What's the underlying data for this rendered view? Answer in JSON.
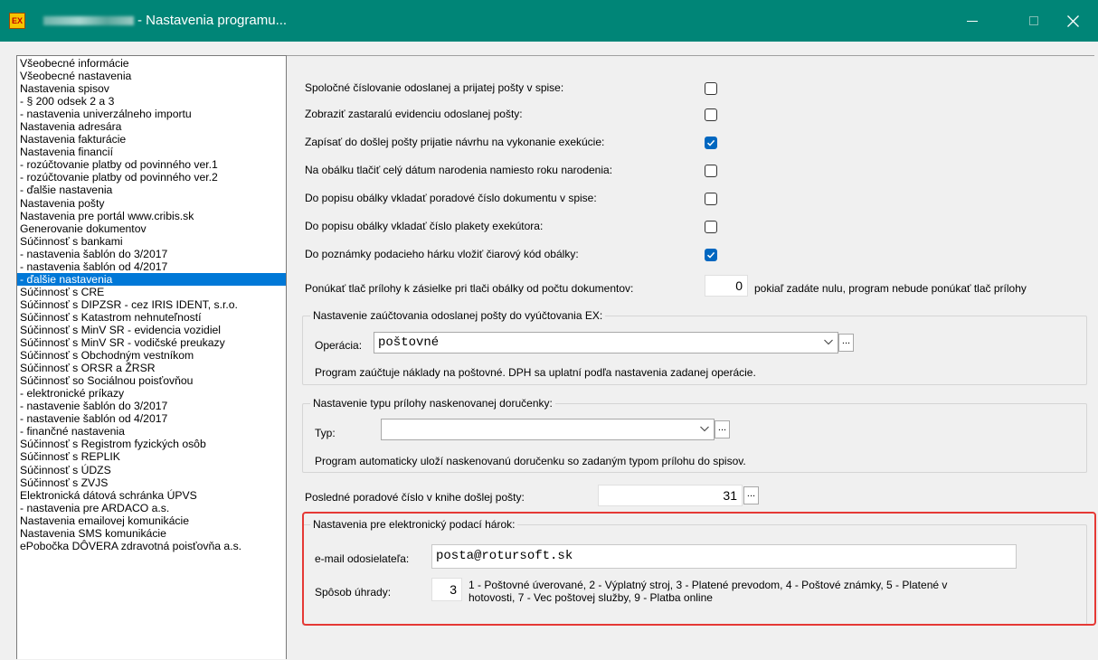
{
  "window": {
    "title": "- Nastavenia programu...",
    "icon_text": "EX",
    "controls": [
      "minimize-icon",
      "maximize-icon",
      "close-icon"
    ]
  },
  "tree": {
    "selected_index": 17,
    "items": [
      "Všeobecné informácie",
      "Všeobecné nastavenia",
      "Nastavenia spisov",
      " - § 200 odsek 2 a 3",
      " - nastavenia univerzálneho importu",
      "Nastavenia adresára",
      "Nastavenia fakturácie",
      "Nastavenia financií",
      " - rozúčtovanie platby od povinného ver.1",
      " - rozúčtovanie platby od povinného ver.2",
      " - ďalšie nastavenia",
      "Nastavenia pošty",
      "Nastavenia pre portál www.cribis.sk",
      "Generovanie dokumentov",
      "Súčinnosť s bankami",
      " - nastavenia šablón do 3/2017",
      " - nastavenia šablón od 4/2017",
      " - ďalšie nastavenia",
      "Súčinnosť s CRE",
      "Súčinnosť s DIPZSR - cez IRIS IDENT, s.r.o.",
      "Súčinnosť s Katastrom nehnuteľností",
      "Súčinnosť s MinV SR - evidencia vozidiel",
      "Súčinnosť s MinV SR - vodičské preukazy",
      "Súčinnosť s Obchodným vestníkom",
      "Súčinnosť s ORSR a ŽRSR",
      "Súčinnosť so Sociálnou poisťovňou",
      " - elektronické príkazy",
      "  - nastavenie šablón do 3/2017",
      "  - nastavenie šablón od 4/2017",
      " - finančné nastavenia",
      "Súčinnosť s Registrom fyzických osôb",
      "Súčinnosť s REPLIK",
      "Súčinnosť s ÚDZS",
      "Súčinnosť s ZVJS",
      "Elektronická dátová schránka ÚPVS",
      " - nastavenia pre ARDACO a.s.",
      "Nastavenia emailovej komunikácie",
      "Nastavenia SMS komunikácie",
      "ePobočka DÔVERA zdravotná poisťovňa a.s."
    ]
  },
  "settings": {
    "checkboxes": [
      {
        "label": "Spoločné číslovanie odoslanej a prijatej pošty v spise:",
        "checked": false
      },
      {
        "label": "Zobraziť zastaralú evidenciu odoslanej pošty:",
        "checked": false
      },
      {
        "label": "Zapísať do došlej pošty prijatie návrhu na vykonanie exekúcie:",
        "checked": true
      },
      {
        "label": "Na obálku tlačiť celý dátum narodenia namiesto roku narodenia:",
        "checked": false
      },
      {
        "label": "Do popisu obálky vkladať poradové číslo dokumentu v spise:",
        "checked": false
      },
      {
        "label": "Do popisu obálky vkladať číslo plakety exekútora:",
        "checked": false
      },
      {
        "label": "Do poznámky podacieho hárku vložiť čiarový kód obálky:",
        "checked": true
      }
    ],
    "attachment_print": {
      "label": "Ponúkať tlač prílohy k zásielke pri tlači obálky od počtu dokumentov:",
      "value": "0",
      "hint": "pokiaľ zadáte nulu, program nebude ponúkať tlač prílohy"
    },
    "accounting_group": {
      "title": "Nastavenie zaúčtovania odoslanej pošty do vyúčtovania EX:",
      "operation_label": "Operácia:",
      "operation_value": "poštovné",
      "dots": "...",
      "note": "Program zaúčtuje náklady na poštovné. DPH sa uplatní podľa nastavenia zadanej operácie."
    },
    "attachment_type_group": {
      "title": "Nastavenie typu prílohy naskenovanej doručenky:",
      "type_label": "Typ:",
      "type_value": "",
      "dots": "...",
      "note": "Program automaticky uloží naskenovanú doručenku so zadaným typom prílohu do spisov."
    },
    "last_number": {
      "label": "Posledné poradové číslo v knihe došlej pošty:",
      "value": "31",
      "dots": "..."
    },
    "e_sheet_group": {
      "title": "Nastavenia pre elektronický podací hárok:",
      "email_label": "e-mail odosielateľa:",
      "email_value": "posta@rotursoft.sk",
      "payment_label": "Spôsob úhrady:",
      "payment_value": "3",
      "payment_desc_line1": "1 - Poštovné úverované, 2 - Výplatný stroj, 3 - Platené prevodom, 4 - Poštové známky, 5 - Platené v",
      "payment_desc_line2": "hotovosti, 7 - Vec poštovej služby, 9 - Platba online"
    }
  },
  "colors": {
    "titlebar": "#008577",
    "selection": "#0078d7",
    "checkbox_on": "#0067c0",
    "highlight_box": "#e53935"
  }
}
